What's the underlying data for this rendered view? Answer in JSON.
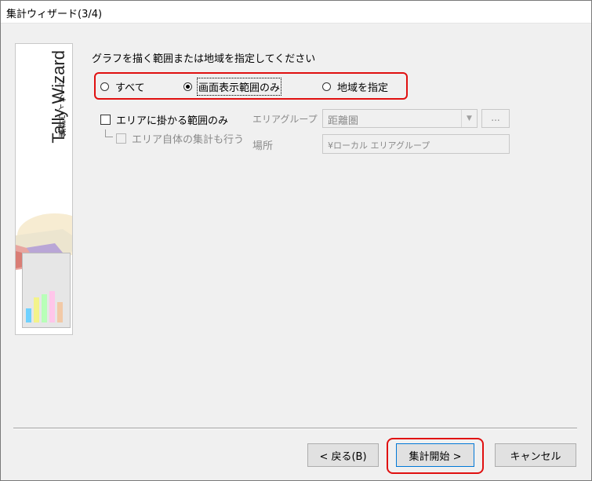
{
  "window": {
    "title": "集計ウィザード(3/4)"
  },
  "banner": {
    "title_en": "Tally Wizard",
    "title_jp": "集計ウィザード"
  },
  "prompt": "グラフを描く範囲または地域を指定してください",
  "radios": [
    {
      "label": "すべて",
      "selected": false
    },
    {
      "label": "画面表示範囲のみ",
      "selected": true
    },
    {
      "label": "地域を指定",
      "selected": false
    }
  ],
  "area_only": {
    "label": "エリアに掛かる範囲のみ",
    "checked": false
  },
  "area_self": {
    "label": "エリア自体の集計も行う",
    "checked": false
  },
  "area_group": {
    "label": "エリアグループ",
    "value": "距離圏",
    "browse_label": "..."
  },
  "location": {
    "label": "場所",
    "value": "¥ローカル エリアグループ"
  },
  "buttons": {
    "back": "< 戻る(B)",
    "next": "集計開始 >",
    "cancel": "キャンセル"
  },
  "colors": {
    "highlight": "#e01010"
  }
}
